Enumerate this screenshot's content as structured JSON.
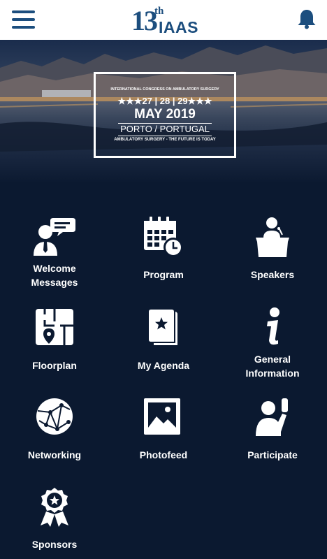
{
  "header": {
    "logo_number": "13",
    "logo_suffix": "th",
    "logo_word": "IAAS"
  },
  "banner": {
    "subtitle": "INTERNATIONAL CONGRESS ON AMBULATORY SURGERY",
    "dates": "★★★27 | 28 | 29★★★",
    "month": "MAY 2019",
    "location": "PORTO / PORTUGAL",
    "tagline": "AMBULATORY SURGERY - THE FUTURE IS TODAY"
  },
  "tiles": [
    {
      "label": "Welcome Messages",
      "icon": "welcome-messages-icon"
    },
    {
      "label": "Program",
      "icon": "calendar-clock-icon"
    },
    {
      "label": "Speakers",
      "icon": "speaker-podium-icon"
    },
    {
      "label": "Floorplan",
      "icon": "floorplan-map-icon"
    },
    {
      "label": "My Agenda",
      "icon": "agenda-book-icon"
    },
    {
      "label": "General Information",
      "icon": "info-icon"
    },
    {
      "label": "Networking",
      "icon": "network-globe-icon"
    },
    {
      "label": "Photofeed",
      "icon": "photo-icon"
    },
    {
      "label": "Participate",
      "icon": "raised-hand-icon"
    },
    {
      "label": "Sponsors",
      "icon": "award-ribbon-icon"
    }
  ],
  "colors": {
    "brand": "#1c4e7e",
    "background": "#0b1930",
    "text": "#ffffff"
  }
}
